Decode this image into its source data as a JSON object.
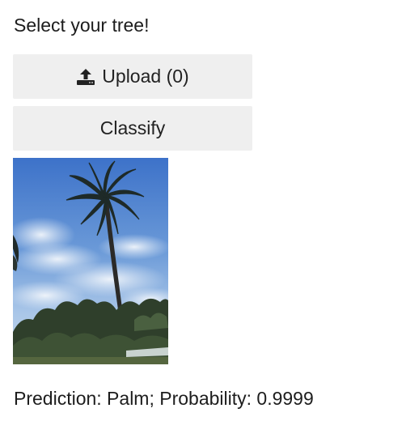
{
  "heading": "Select your tree!",
  "upload_button": {
    "label": "Upload (0)",
    "icon": "upload-icon"
  },
  "classify_button": {
    "label": "Classify"
  },
  "preview_image": {
    "subject": "palm-tree-photo"
  },
  "result": {
    "text": "Prediction: Palm; Probability: 0.9999"
  }
}
